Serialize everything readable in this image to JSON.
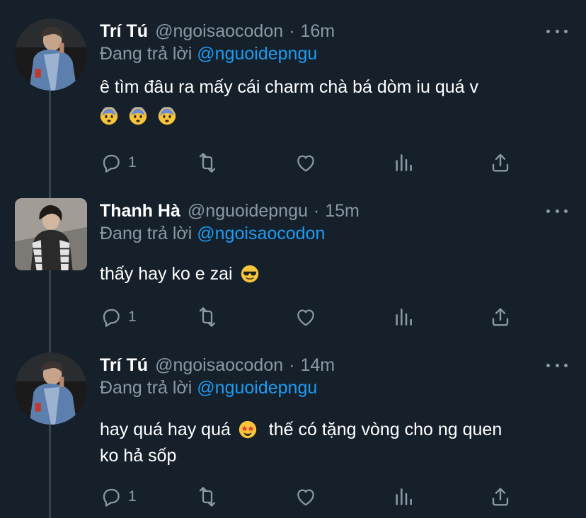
{
  "tweets": [
    {
      "name": "Trí Tú",
      "handle": "@ngoisaocodon",
      "time": "16m",
      "replying_label": "Đang trả lời",
      "replying_to": "@nguoidepngu",
      "text_line1": "ê tìm đâu ra mấy cái charm chà bá dòm iu quá v",
      "emoji_line": [
        "fearful-face",
        "fearful-face",
        "fearful-face"
      ],
      "reply_count": "1"
    },
    {
      "name": "Thanh Hà",
      "handle": "@nguoidepngu",
      "time": "15m",
      "replying_label": "Đang trả lời",
      "replying_to": "@ngoisaocodon",
      "text_line1": "thấy hay ko e zai",
      "emoji_after": "smiling-face-with-sunglasses",
      "reply_count": "1"
    },
    {
      "name": "Trí Tú",
      "handle": "@ngoisaocodon",
      "time": "14m",
      "replying_label": "Đang trả lời",
      "replying_to": "@nguoidepngu",
      "text_before_emoji": "hay quá hay quá",
      "emoji_mid": "star-struck",
      "text_after_emoji": "thế có tặng vòng cho ng quen",
      "text_line2": "ko hả sốp",
      "reply_count": "1"
    }
  ],
  "separator": "·",
  "actions": [
    "reply-icon",
    "retweet-icon",
    "like-icon",
    "views-icon",
    "share-icon"
  ],
  "colors": {
    "background": "#15202b",
    "text": "#ffffff",
    "secondary": "#8b98a5",
    "mention": "#1d9bf0",
    "thread_line": "#38444d"
  }
}
